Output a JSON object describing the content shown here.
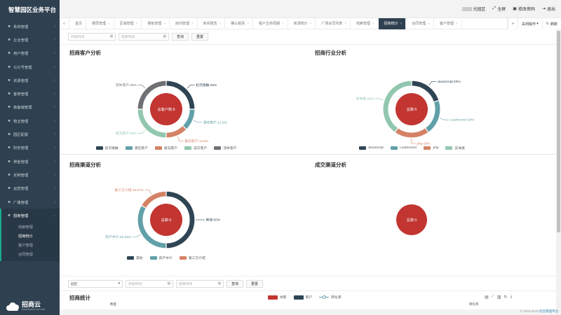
{
  "app": {
    "title": "智慧园区业务平台"
  },
  "sidebar": {
    "items": [
      {
        "label": "系统管理",
        "icon": "monitor-icon"
      },
      {
        "label": "企业管理",
        "icon": "building-icon"
      },
      {
        "label": "用户管理",
        "icon": "user-icon"
      },
      {
        "label": "公众号管理",
        "icon": "wechat-icon"
      },
      {
        "label": "资源管理",
        "icon": "box-icon"
      },
      {
        "label": "客商管理",
        "icon": "handshake-icon"
      },
      {
        "label": "装备缩管理",
        "icon": "tool-icon"
      },
      {
        "label": "物业管理",
        "icon": "home-icon"
      },
      {
        "label": "园区配置",
        "icon": "config-icon"
      },
      {
        "label": "财务管理",
        "icon": "wallet-icon"
      },
      {
        "label": "押金管理",
        "icon": "deposit-icon"
      },
      {
        "label": "定制管理",
        "icon": "custom-icon"
      },
      {
        "label": "运营管理",
        "icon": "chart-icon"
      },
      {
        "label": "广播管理",
        "icon": "broadcast-icon"
      },
      {
        "label": "招商管理",
        "icon": "briefcase-icon"
      }
    ],
    "subitems": [
      "线索管理",
      "招商统计",
      "客户管理",
      "合同管理"
    ],
    "logo_text": "招商云",
    "logo_sub": "ZHAOSHANGYUN.COM"
  },
  "topbar": {
    "park": "光园区",
    "fullscreen": "全屏",
    "change_password": "修改密码",
    "logout": "退出"
  },
  "tabs": {
    "items": [
      "首页",
      "楼层管理",
      "区域管理",
      "楼栋管理",
      "房间管理",
      "房间报告",
      "确认租赁",
      "租户生命周期",
      "房源统计",
      "广场会员列表",
      "线索管理",
      "招商统计",
      "合同管理",
      "客户管理"
    ],
    "active_index": 11,
    "close_label": "关闭操作",
    "refresh_label": "刷新"
  },
  "filter": {
    "start_placeholder": "开始时间",
    "end_placeholder": "结束时间",
    "query": "查询",
    "reset": "重置"
  },
  "panels": {
    "customer": {
      "title": "招商客户分析",
      "center": "总客户数:8"
    },
    "industry": {
      "title": "招商行业分析",
      "center": "总数:5"
    },
    "channel": {
      "title": "招商渠道分析",
      "center": "总数:6"
    },
    "deal": {
      "title": "成交渠道分析",
      "center": "总数:0"
    }
  },
  "chart_data": [
    {
      "type": "pie",
      "title": "招商客户分析",
      "center_label": "总客户数:8",
      "slices": [
        {
          "name": "初次接触",
          "value": 25,
          "label": "初次接触:25%",
          "color": "#2f4554"
        },
        {
          "name": "潜在客户",
          "value": 12.5,
          "label": "潜在客户:12.5%",
          "color": "#61a0a8"
        },
        {
          "name": "意向客户",
          "value": 12.5,
          "label": "意向客户:12.5%",
          "color": "#d48265"
        },
        {
          "name": "成交客户",
          "value": 25,
          "label": "成交客户:25%",
          "color": "#91c7ae"
        },
        {
          "name": "流失客户",
          "value": 25,
          "label": "流失客户:25%",
          "color": "#6e7074"
        }
      ],
      "legend_position": "bottom"
    },
    {
      "type": "pie",
      "title": "招商行业分析",
      "center_label": "总数:5",
      "slices": [
        {
          "name": "JavaScript",
          "value": 20,
          "label": "JavaScript:20%",
          "color": "#2f4554"
        },
        {
          "name": "Loadrunner",
          "value": 20,
          "label": "Loadrunner:20%",
          "color": "#61a0a8"
        },
        {
          "name": "php",
          "value": 20,
          "label": "php:20%",
          "color": "#d48265"
        },
        {
          "name": "实体类",
          "value": 40,
          "label": "实体类:40%",
          "color": "#91c7ae"
        }
      ],
      "legend_position": "bottom"
    },
    {
      "type": "pie",
      "title": "招商渠道分析",
      "center_label": "总数:6",
      "slices": [
        {
          "name": "其他",
          "value": 50,
          "label": "其他:50%",
          "color": "#2f4554"
        },
        {
          "name": "房产中介",
          "value": 33.33,
          "label": "房产中介:33.33%",
          "color": "#61a0a8"
        },
        {
          "name": "第三方介绍",
          "value": 16.67,
          "label": "第三方介绍:16.67%",
          "color": "#d48265"
        }
      ],
      "legend_position": "bottom"
    },
    {
      "type": "pie",
      "title": "成交渠道分析",
      "center_label": "总数:0",
      "slices": []
    },
    {
      "type": "bar",
      "title": "招商统计",
      "series": [
        {
          "name": "线索",
          "color": "#c23531"
        },
        {
          "name": "客户",
          "color": "#2f4554"
        },
        {
          "name": "转化率",
          "color": "#61a0a8"
        }
      ],
      "ylabel": "数量",
      "y2label": "转化率"
    }
  ],
  "bottom_filter": {
    "park_select": "园区",
    "start_placeholder": "开始时间",
    "end_placeholder": "结束时间",
    "query": "查询",
    "reset": "重置"
  },
  "stats": {
    "title": "招商统计",
    "ylabel": "数量",
    "y2label": "转化率"
  },
  "footer": {
    "copyright": "© 2016-2018 ",
    "link": "综合管理平台"
  },
  "colors": {
    "sidebar_bg": "#2f4050",
    "accent": "#19aa8d",
    "center_fill": "#c23531"
  }
}
